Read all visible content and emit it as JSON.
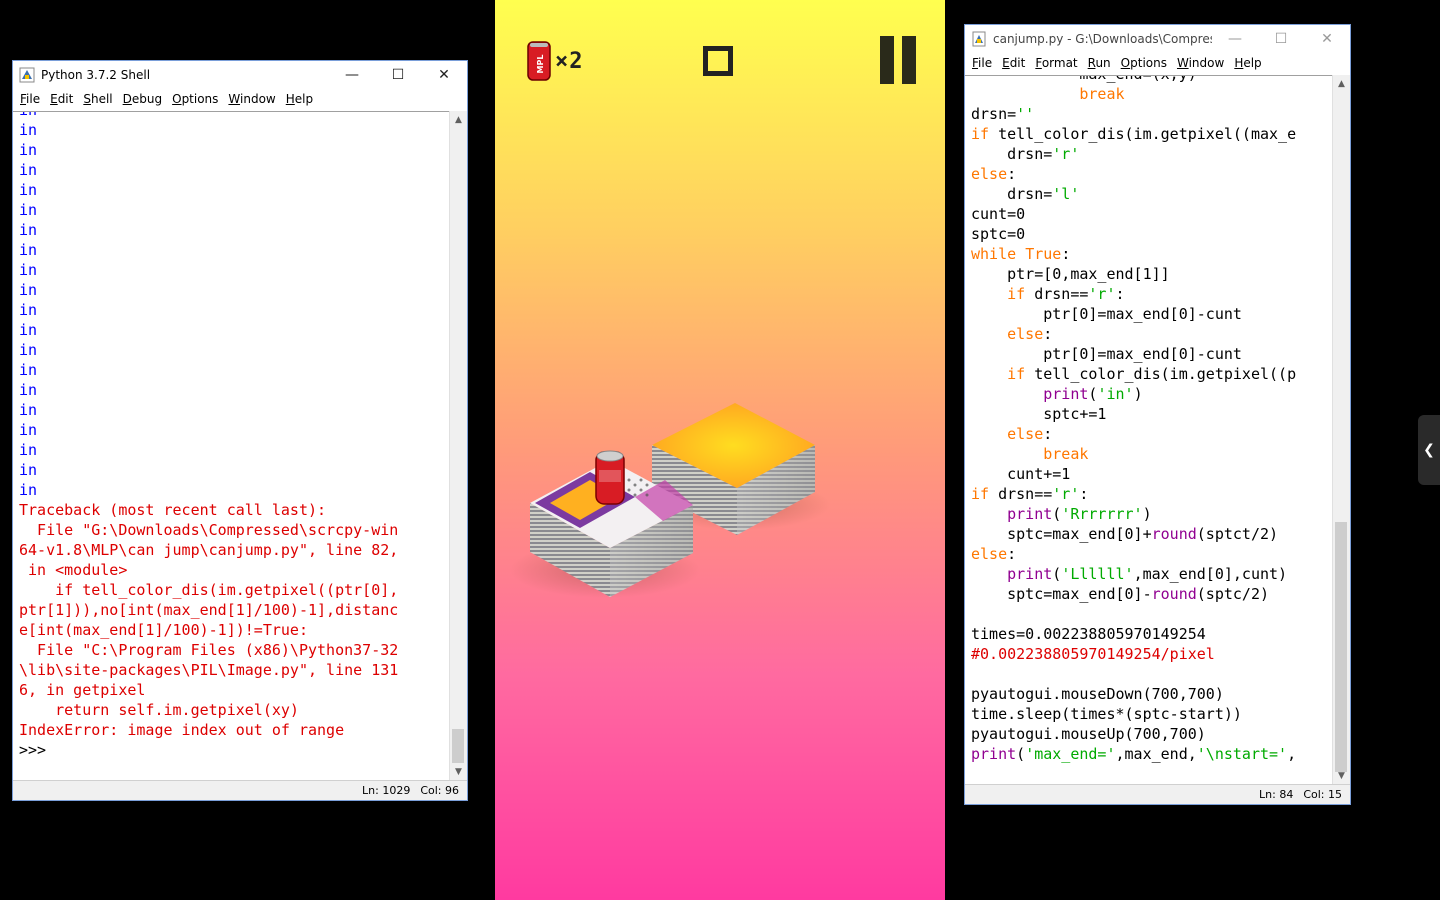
{
  "shell": {
    "title": "Python 3.7.2 Shell",
    "menu": [
      "File",
      "Edit",
      "Shell",
      "Debug",
      "Options",
      "Window",
      "Help"
    ],
    "output_in": [
      "in",
      "in",
      "in",
      "in",
      "in",
      "in",
      "in",
      "in",
      "in",
      "in",
      "in",
      "in",
      "in",
      "in",
      "in",
      "in",
      "in",
      "in",
      "in",
      "in"
    ],
    "traceback": [
      "Traceback (most recent call last):",
      "  File \"G:\\Downloads\\Compressed\\scrcpy-win",
      "64-v1.8\\MLP\\can jump\\canjump.py\", line 82,",
      " in <module>",
      "    if tell_color_dis(im.getpixel((ptr[0],",
      "ptr[1])),no[int(max_end[1]/100)-1],distanc",
      "e[int(max_end[1]/100)-1])!=True:",
      "  File \"C:\\Program Files (x86)\\Python37-32",
      "\\lib\\site-packages\\PIL\\Image.py\", line 131",
      "6, in getpixel",
      "    return self.im.getpixel(xy)",
      "IndexError: image index out of range"
    ],
    "prompt": ">>>",
    "status_ln": "Ln: 1029",
    "status_col": "Col: 96"
  },
  "editor": {
    "title": "canjump.py - G:\\Downloads\\Compress...",
    "menu": [
      "File",
      "Edit",
      "Format",
      "Run",
      "Options",
      "Window",
      "Help"
    ],
    "status_ln": "Ln: 84",
    "status_col": "Col: 15",
    "lines": [
      [
        [
          "            max_end=(x,y)",
          "blk"
        ]
      ],
      [
        [
          "            ",
          "blk"
        ],
        [
          "break",
          "kw"
        ]
      ],
      [
        [
          "drsn=",
          "blk"
        ],
        [
          "''",
          "str"
        ]
      ],
      [
        [
          "if",
          "kw"
        ],
        [
          " tell_color_dis(im.getpixel((max_e",
          "blk"
        ]
      ],
      [
        [
          "    drsn=",
          "blk"
        ],
        [
          "'r'",
          "str"
        ]
      ],
      [
        [
          "else",
          "kw"
        ],
        [
          ":",
          "blk"
        ]
      ],
      [
        [
          "    drsn=",
          "blk"
        ],
        [
          "'l'",
          "str"
        ]
      ],
      [
        [
          "cunt=0",
          "blk"
        ]
      ],
      [
        [
          "sptc=0",
          "blk"
        ]
      ],
      [
        [
          "while",
          "kw"
        ],
        [
          " ",
          "blk"
        ],
        [
          "True",
          "kw"
        ],
        [
          ":",
          "blk"
        ]
      ],
      [
        [
          "    ptr=[0,max_end[1]]",
          "blk"
        ]
      ],
      [
        [
          "    ",
          "blk"
        ],
        [
          "if",
          "kw"
        ],
        [
          " drsn==",
          "blk"
        ],
        [
          "'r'",
          "str"
        ],
        [
          ":",
          "blk"
        ]
      ],
      [
        [
          "        ptr[0]=max_end[0]-cunt",
          "blk"
        ]
      ],
      [
        [
          "    ",
          "blk"
        ],
        [
          "else",
          "kw"
        ],
        [
          ":",
          "blk"
        ]
      ],
      [
        [
          "        ptr[0]=max_end[0]-cunt",
          "blk"
        ]
      ],
      [
        [
          "    ",
          "blk"
        ],
        [
          "if",
          "kw"
        ],
        [
          " tell_color_dis(im.getpixel((p",
          "blk"
        ]
      ],
      [
        [
          "        ",
          "blk"
        ],
        [
          "print",
          "bi"
        ],
        [
          "(",
          "blk"
        ],
        [
          "'in'",
          "str"
        ],
        [
          ")",
          "blk"
        ]
      ],
      [
        [
          "        sptc+=1",
          "blk"
        ]
      ],
      [
        [
          "    ",
          "blk"
        ],
        [
          "else",
          "kw"
        ],
        [
          ":",
          "blk"
        ]
      ],
      [
        [
          "        ",
          "blk"
        ],
        [
          "break",
          "kw"
        ]
      ],
      [
        [
          "    cunt+=1",
          "blk"
        ]
      ],
      [
        [
          "if",
          "kw"
        ],
        [
          " drsn==",
          "blk"
        ],
        [
          "'r'",
          "str"
        ],
        [
          ":",
          "blk"
        ]
      ],
      [
        [
          "    ",
          "blk"
        ],
        [
          "print",
          "bi"
        ],
        [
          "(",
          "blk"
        ],
        [
          "'Rrrrrrr'",
          "str"
        ],
        [
          ")",
          "blk"
        ]
      ],
      [
        [
          "    sptc=max_end[0]+",
          "blk"
        ],
        [
          "round",
          "bi"
        ],
        [
          "(sptct/2)",
          "blk"
        ]
      ],
      [
        [
          "else",
          "kw"
        ],
        [
          ":",
          "blk"
        ]
      ],
      [
        [
          "    ",
          "blk"
        ],
        [
          "print",
          "bi"
        ],
        [
          "(",
          "blk"
        ],
        [
          "'Llllll'",
          "str"
        ],
        [
          ",max_end[0],cunt)",
          "blk"
        ]
      ],
      [
        [
          "    sptc=max_end[0]-",
          "blk"
        ],
        [
          "round",
          "bi"
        ],
        [
          "(sptc/2)",
          "blk"
        ]
      ],
      [
        [
          "",
          "blk"
        ]
      ],
      [
        [
          "times=0.002238805970149254",
          "blk"
        ]
      ],
      [
        [
          "#0.002238805970149254/pixel",
          "cm"
        ]
      ],
      [
        [
          "",
          "blk"
        ]
      ],
      [
        [
          "pyautogui.mouseDown(700,700)",
          "blk"
        ]
      ],
      [
        [
          "time.sleep(times*(sptc-start))",
          "blk"
        ]
      ],
      [
        [
          "pyautogui.mouseUp(700,700)",
          "blk"
        ]
      ],
      [
        [
          "print",
          "bi"
        ],
        [
          "(",
          "blk"
        ],
        [
          "'max_end='",
          "str"
        ],
        [
          ",max_end,",
          "blk"
        ],
        [
          "'\\nstart='",
          "str"
        ],
        [
          ",",
          "blk"
        ]
      ]
    ]
  },
  "game": {
    "multiplier": "×2",
    "can_label": "MPL",
    "colors": {
      "gradient_top": "#ffff4f",
      "gradient_bottom": "#ff3aa0"
    }
  }
}
